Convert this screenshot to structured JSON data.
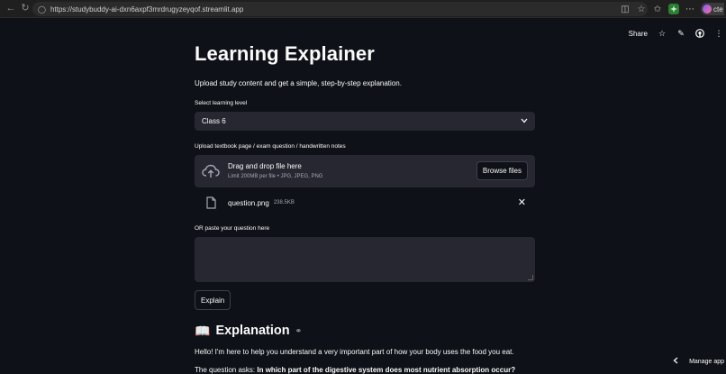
{
  "browser": {
    "url": "https://studybuddy-ai-dxn6axpf3mrdrugyzeyqof.streamlit.app",
    "profile_text": "cte"
  },
  "toolbar": {
    "share_label": "Share"
  },
  "main": {
    "title": "Learning Explainer",
    "subtitle": "Upload study content and get a simple, step-by-step explanation.",
    "level_label": "Select learning level",
    "level_value": "Class 6",
    "upload_label": "Upload textbook page / exam question / handwritten notes",
    "dropzone_title": "Drag and drop file here",
    "dropzone_limits": "Limit 200MB per file • JPG, JPEG, PNG",
    "browse_label": "Browse files",
    "file": {
      "name": "question.png",
      "size": "238.5KB"
    },
    "paste_label": "OR paste your question here",
    "paste_value": "",
    "explain_label": "Explain"
  },
  "explanation": {
    "icon": "📖",
    "title": "Explanation",
    "paragraph1": "Hello! I'm here to help you understand a very important part of how your body uses the food you eat.",
    "question_intro": "The question asks: ",
    "question_bold": "In which part of the digestive system does most nutrient absorption occur?"
  },
  "footer": {
    "manage_label": "Manage app"
  },
  "colors": {
    "background": "#0e1117",
    "widget": "#262730",
    "text": "#fafafa",
    "muted": "#a3a8b4"
  }
}
